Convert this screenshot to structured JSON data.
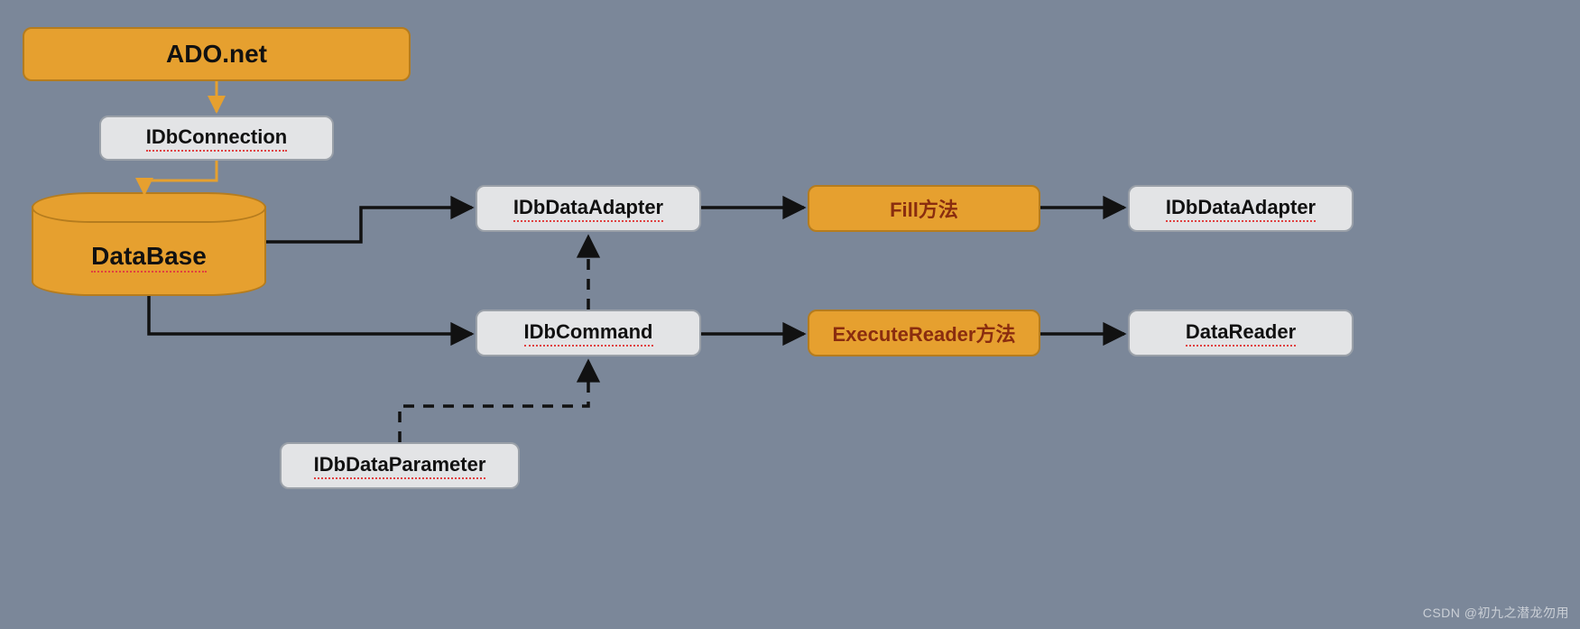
{
  "nodes": {
    "ado_net": "ADO.net",
    "idbconnection": "IDbConnection",
    "database": "DataBase",
    "idbdataadapter1": "IDbDataAdapter",
    "fill": "Fill方法",
    "idbdataadapter2": "IDbDataAdapter",
    "idbcommand": "IDbCommand",
    "executereader": "ExecuteReader方法",
    "datareader": "DataReader",
    "idbdataparameter": "IDbDataParameter"
  },
  "watermark": "CSDN @初九之潜龙勿用",
  "edges": [
    {
      "from": "ado_net",
      "to": "idbconnection",
      "style": "solid",
      "color": "orange"
    },
    {
      "from": "idbconnection",
      "to": "database",
      "style": "solid",
      "color": "orange"
    },
    {
      "from": "database",
      "to": "idbdataadapter1",
      "style": "solid",
      "color": "black"
    },
    {
      "from": "idbdataadapter1",
      "to": "fill",
      "style": "solid",
      "color": "black"
    },
    {
      "from": "fill",
      "to": "idbdataadapter2",
      "style": "solid",
      "color": "black"
    },
    {
      "from": "database",
      "to": "idbcommand",
      "style": "solid",
      "color": "black"
    },
    {
      "from": "idbcommand",
      "to": "executereader",
      "style": "solid",
      "color": "black"
    },
    {
      "from": "executereader",
      "to": "datareader",
      "style": "solid",
      "color": "black"
    },
    {
      "from": "idbcommand",
      "to": "idbdataadapter1",
      "style": "dashed",
      "color": "black"
    },
    {
      "from": "idbdataparameter",
      "to": "idbcommand",
      "style": "dashed",
      "color": "black"
    }
  ]
}
